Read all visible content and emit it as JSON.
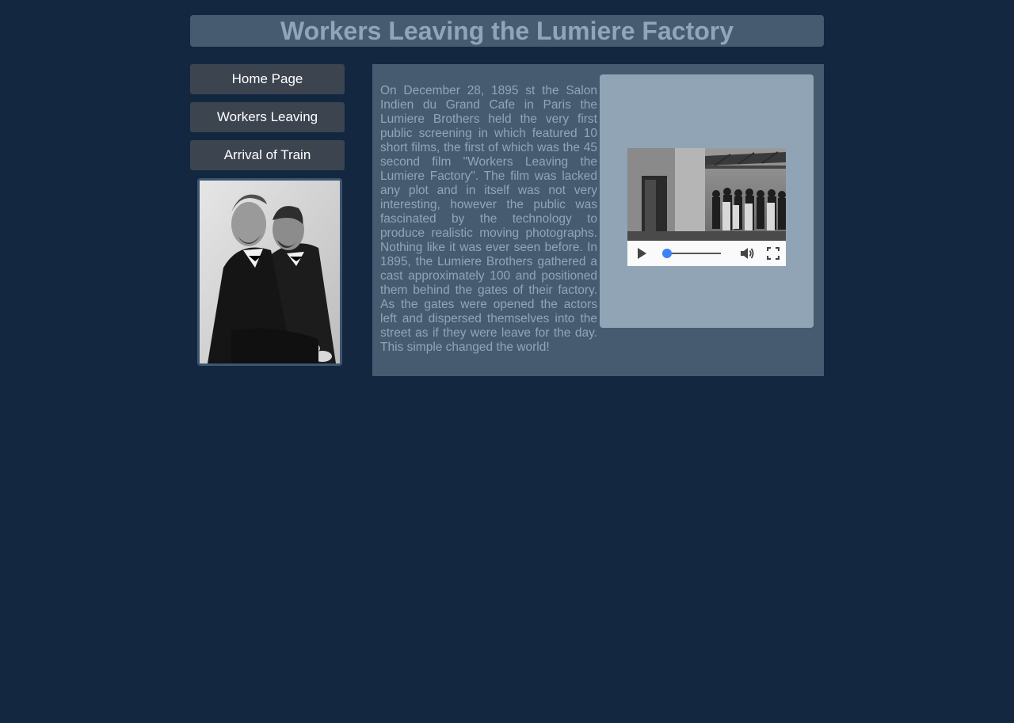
{
  "header": {
    "title": "Workers Leaving the Lumiere Factory"
  },
  "nav": {
    "items": [
      {
        "label": "Home Page"
      },
      {
        "label": "Workers Leaving"
      },
      {
        "label": "Arrival of Train"
      }
    ]
  },
  "sidebar": {
    "portrait_icon": "lumiere-brothers-portrait"
  },
  "main": {
    "article_text": "On December 28, 1895 st the Salon Indien du Grand Cafe in Paris the Lumiere Brothers held the very first public screening in which featured 10 short films, the first of which was the 45 second film \"Workers Leaving the Lumiere Factory\". The film was lacked any plot and in itself was not very interesting, however the public was fascinated by the technology to produce realistic moving photographs. Nothing like it was ever seen before. In 1895, the Lumiere Brothers gathered a cast approximately 100 and positioned them behind the gates of their factory. As the gates were opened the actors left and dispersed themselves into the street as if they were leave for the day. This simple changed the world!",
    "video": {
      "progress": 0,
      "play_icon": "play-icon",
      "volume_icon": "volume-icon",
      "fullscreen_icon": "fullscreen-icon"
    }
  },
  "colors": {
    "page_background": "#132840",
    "panel_background": "#475b70",
    "title_text": "#8fa5b8",
    "nav_button": "#3c4450",
    "video_box": "#91a4b5",
    "slider_accent": "#3b82f6"
  }
}
